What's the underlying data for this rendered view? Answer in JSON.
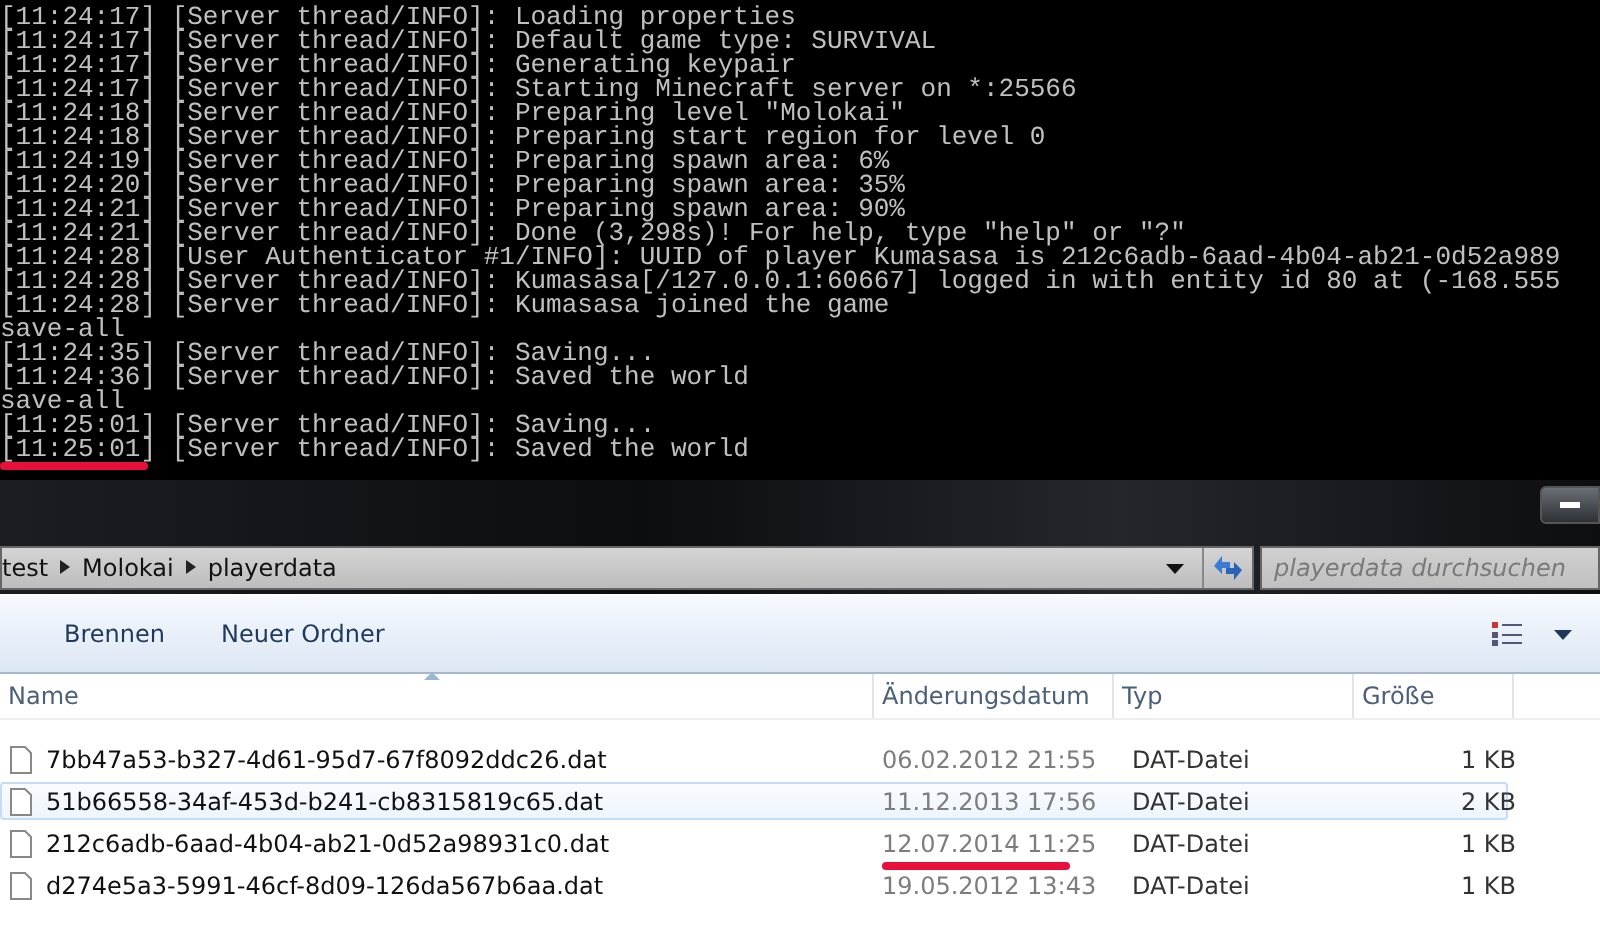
{
  "console": {
    "lines": [
      {
        "text": "[11:24:17] [Server thread/INFO]: Loading properties",
        "marked": false
      },
      {
        "text": "[11:24:17] [Server thread/INFO]: Default game type: SURVIVAL",
        "marked": false
      },
      {
        "text": "[11:24:17] [Server thread/INFO]: Generating keypair",
        "marked": false
      },
      {
        "text": "[11:24:17] [Server thread/INFO]: Starting Minecraft server on *:25566",
        "marked": false
      },
      {
        "text": "[11:24:18] [Server thread/INFO]: Preparing level \"Molokai\"",
        "marked": false
      },
      {
        "text": "[11:24:18] [Server thread/INFO]: Preparing start region for level 0",
        "marked": false
      },
      {
        "text": "[11:24:19] [Server thread/INFO]: Preparing spawn area: 6%",
        "marked": false
      },
      {
        "text": "[11:24:20] [Server thread/INFO]: Preparing spawn area: 35%",
        "marked": false
      },
      {
        "text": "[11:24:21] [Server thread/INFO]: Preparing spawn area: 90%",
        "marked": false
      },
      {
        "text": "[11:24:21] [Server thread/INFO]: Done (3,298s)! For help, type \"help\" or \"?\"",
        "marked": false
      },
      {
        "text": "[11:24:28] [User Authenticator #1/INFO]: UUID of player Kumasasa is 212c6adb-6aad-4b04-ab21-0d52a989",
        "marked": false
      },
      {
        "text": "[11:24:28] [Server thread/INFO]: Kumasasa[/127.0.0.1:60667] logged in with entity id 80 at (-168.555",
        "marked": false
      },
      {
        "text": "[11:24:28] [Server thread/INFO]: Kumasasa joined the game",
        "marked": false
      },
      {
        "text": "save-all",
        "marked": false
      },
      {
        "text": "[11:24:35] [Server thread/INFO]: Saving...",
        "marked": false
      },
      {
        "text": "[11:24:36] [Server thread/INFO]: Saved the world",
        "marked": false
      },
      {
        "text": "save-all",
        "marked": false
      },
      {
        "text": "[11:25:01] [Server thread/INFO]: Saving...",
        "marked": false
      },
      {
        "text": "[11:25:01] [Server thread/INFO]: Saved the world",
        "marked": true
      }
    ]
  },
  "explorer": {
    "breadcrumb": [
      "test",
      "Molokai",
      "playerdata"
    ],
    "search": {
      "placeholder": "playerdata durchsuchen"
    },
    "toolbar": [
      "Brennen",
      "Neuer Ordner"
    ],
    "columns": [
      "Name",
      "Änderungsdatum",
      "Typ",
      "Größe"
    ],
    "rows": [
      {
        "name": "7bb47a53-b327-4d61-95d7-67f8092ddc26.dat",
        "date": "06.02.2012 21:55",
        "type": "DAT-Datei",
        "size": "1 KB",
        "hovered": false,
        "marked": false
      },
      {
        "name": "51b66558-34af-453d-b241-cb8315819c65.dat",
        "date": "11.12.2013 17:56",
        "type": "DAT-Datei",
        "size": "2 KB",
        "hovered": true,
        "marked": false
      },
      {
        "name": "212c6adb-6aad-4b04-ab21-0d52a98931c0.dat",
        "date": "12.07.2014 11:25",
        "type": "DAT-Datei",
        "size": "1 KB",
        "hovered": false,
        "marked": true
      },
      {
        "name": "d274e5a3-5991-46cf-8d09-126da567b6aa.dat",
        "date": "19.05.2012 13:43",
        "type": "DAT-Datei",
        "size": "1 KB",
        "hovered": false,
        "marked": false
      }
    ]
  }
}
